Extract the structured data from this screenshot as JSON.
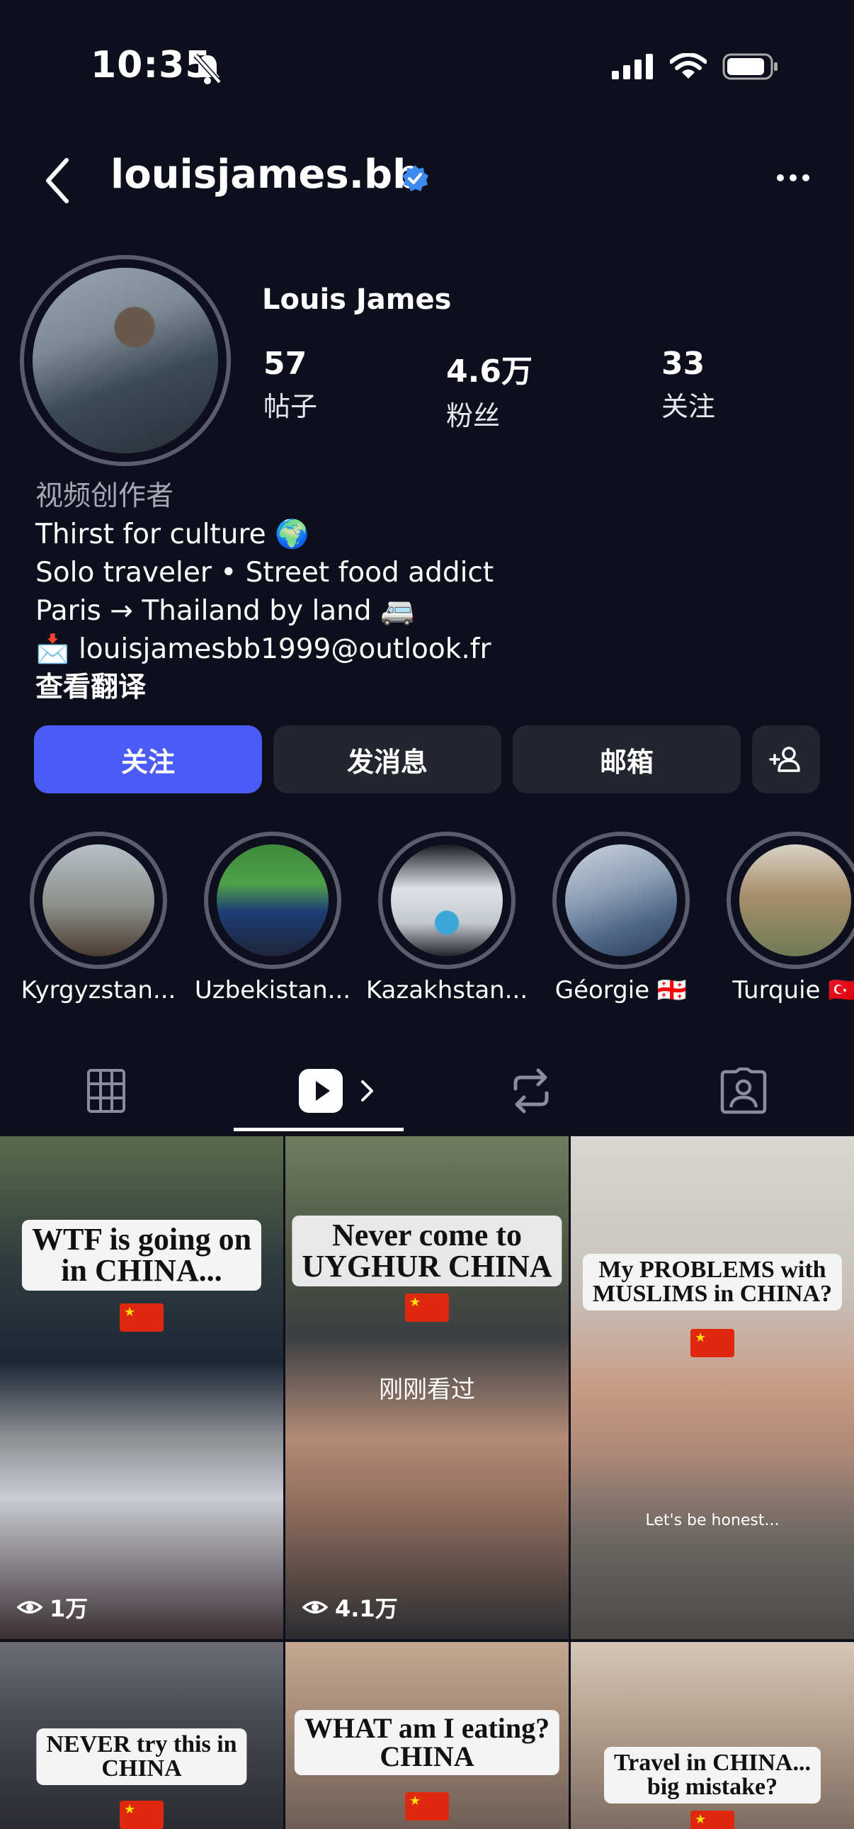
{
  "status_bar": {
    "time": "10:35"
  },
  "header": {
    "username": "louisjames.bb"
  },
  "profile": {
    "full_name": "Louis James",
    "stats": [
      {
        "number": "57",
        "label": "帖子"
      },
      {
        "number": "4.6万",
        "label": "粉丝"
      },
      {
        "number": "33",
        "label": "关注"
      }
    ],
    "bio": {
      "category": "视频创作者",
      "lines": [
        "Thirst for culture 🌍",
        "Solo traveler • Street food addict",
        "Paris → Thailand by land 🚐",
        "📩 louisjamesbb1999@outlook.fr"
      ],
      "translate_label": "查看翻译"
    }
  },
  "actions": {
    "follow_label": "关注",
    "message_label": "发消息",
    "email_label": "邮箱"
  },
  "highlights": [
    {
      "label": "Kyrgyzstan..."
    },
    {
      "label": "Uzbekistan..."
    },
    {
      "label": "Kazakhstan..."
    },
    {
      "label": "Géorgie 🇬🇪"
    },
    {
      "label": "Turquie 🇹🇷"
    }
  ],
  "tabs": [
    "grid",
    "reels",
    "reposts",
    "tagged"
  ],
  "posts": [
    {
      "title_1": "WTF is going on",
      "title_2": "in CHINA...",
      "views": "1万"
    },
    {
      "title_1": "Never come to",
      "title_2": "UYGHUR CHINA",
      "overlay": "刚刚看过",
      "views": "4.1万"
    },
    {
      "title_1": "My PROBLEMS with",
      "title_2": "MUSLIMS in CHINA?",
      "caption": "Let's be honest..."
    },
    {
      "title_1": "NEVER try this in",
      "title_2": "CHINA"
    },
    {
      "title_1": "WHAT am I eating?",
      "title_2": "CHINA"
    },
    {
      "title_1": "Travel in CHINA...",
      "title_2": "big mistake?"
    }
  ],
  "colors": {
    "background": "#0d0f1c",
    "primary": "#4a5cf5",
    "button": "#23262f",
    "verified": "#3d8bf2"
  }
}
